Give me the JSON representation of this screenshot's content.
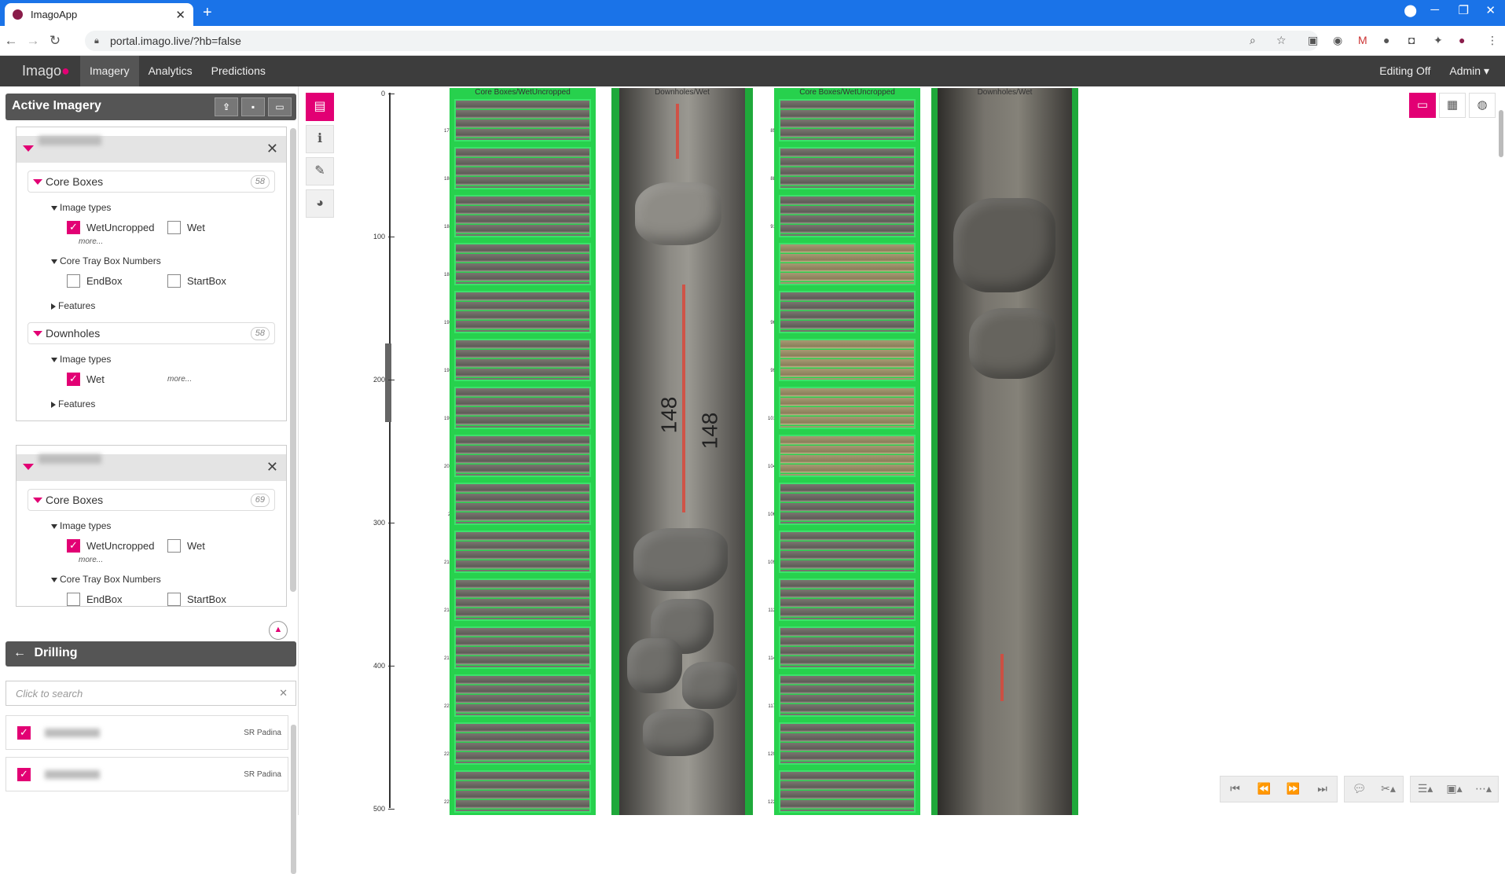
{
  "browser": {
    "tab_title": "ImagoApp",
    "url": "portal.imago.live/?hb=false",
    "new_tab": "+",
    "close_tab": "✕"
  },
  "app": {
    "logo_text": "Imago",
    "nav": [
      "Imagery",
      "Analytics",
      "Predictions"
    ],
    "editing": "Editing Off",
    "admin": "Admin ▾"
  },
  "active_imagery": {
    "title": "Active Imagery",
    "projects": [
      {
        "datasets": [
          {
            "name": "Core Boxes",
            "count": "58",
            "image_types_label": "Image types",
            "options": [
              {
                "label": "WetUncropped",
                "checked": true
              },
              {
                "label": "Wet",
                "checked": false
              }
            ],
            "more": "more...",
            "tray_label": "Core Tray Box Numbers",
            "tray_options": [
              {
                "label": "EndBox",
                "checked": false
              },
              {
                "label": "StartBox",
                "checked": false
              }
            ],
            "features_label": "Features"
          },
          {
            "name": "Downholes",
            "count": "58",
            "image_types_label": "Image types",
            "options": [
              {
                "label": "Wet",
                "checked": true
              }
            ],
            "more": "more...",
            "features_label": "Features"
          }
        ]
      },
      {
        "datasets": [
          {
            "name": "Core Boxes",
            "count": "69",
            "image_types_label": "Image types",
            "options": [
              {
                "label": "WetUncropped",
                "checked": true
              },
              {
                "label": "Wet",
                "checked": false
              }
            ],
            "more": "more...",
            "tray_label": "Core Tray Box Numbers",
            "tray_options": [
              {
                "label": "EndBox",
                "checked": false
              },
              {
                "label": "StartBox",
                "checked": false
              }
            ]
          }
        ]
      }
    ]
  },
  "drilling": {
    "title": "Drilling",
    "search_placeholder": "Click to search",
    "items": [
      {
        "geologist": "SR Padina",
        "checked": true
      },
      {
        "geologist": "SR Padina",
        "checked": true
      }
    ]
  },
  "viewer": {
    "depth_ticks": [
      "0",
      "100",
      "200",
      "300",
      "400",
      "500"
    ],
    "columns": [
      {
        "title": "Core Boxes/WetUncropped"
      },
      {
        "title": "Downholes/Wet"
      },
      {
        "title": "Core Boxes/WetUncropped"
      },
      {
        "title": "Downholes/Wet"
      }
    ],
    "col1_ticks": [
      "177.1",
      "180.7",
      "184.3",
      "188.2",
      "191.9",
      "195.3",
      "199.3",
      "203.2",
      "207",
      "210.7",
      "214.4",
      "217.9",
      "221.6",
      "225.4",
      "229.2"
    ],
    "col3_ticks": [
      "85.9",
      "88.7",
      "91.3",
      "94",
      "96.6",
      "99.2",
      "101.7",
      "104.3",
      "106.9",
      "109.7",
      "112.3",
      "114.9",
      "117.5",
      "120.2",
      "122.9"
    ],
    "core_marking": "148"
  }
}
